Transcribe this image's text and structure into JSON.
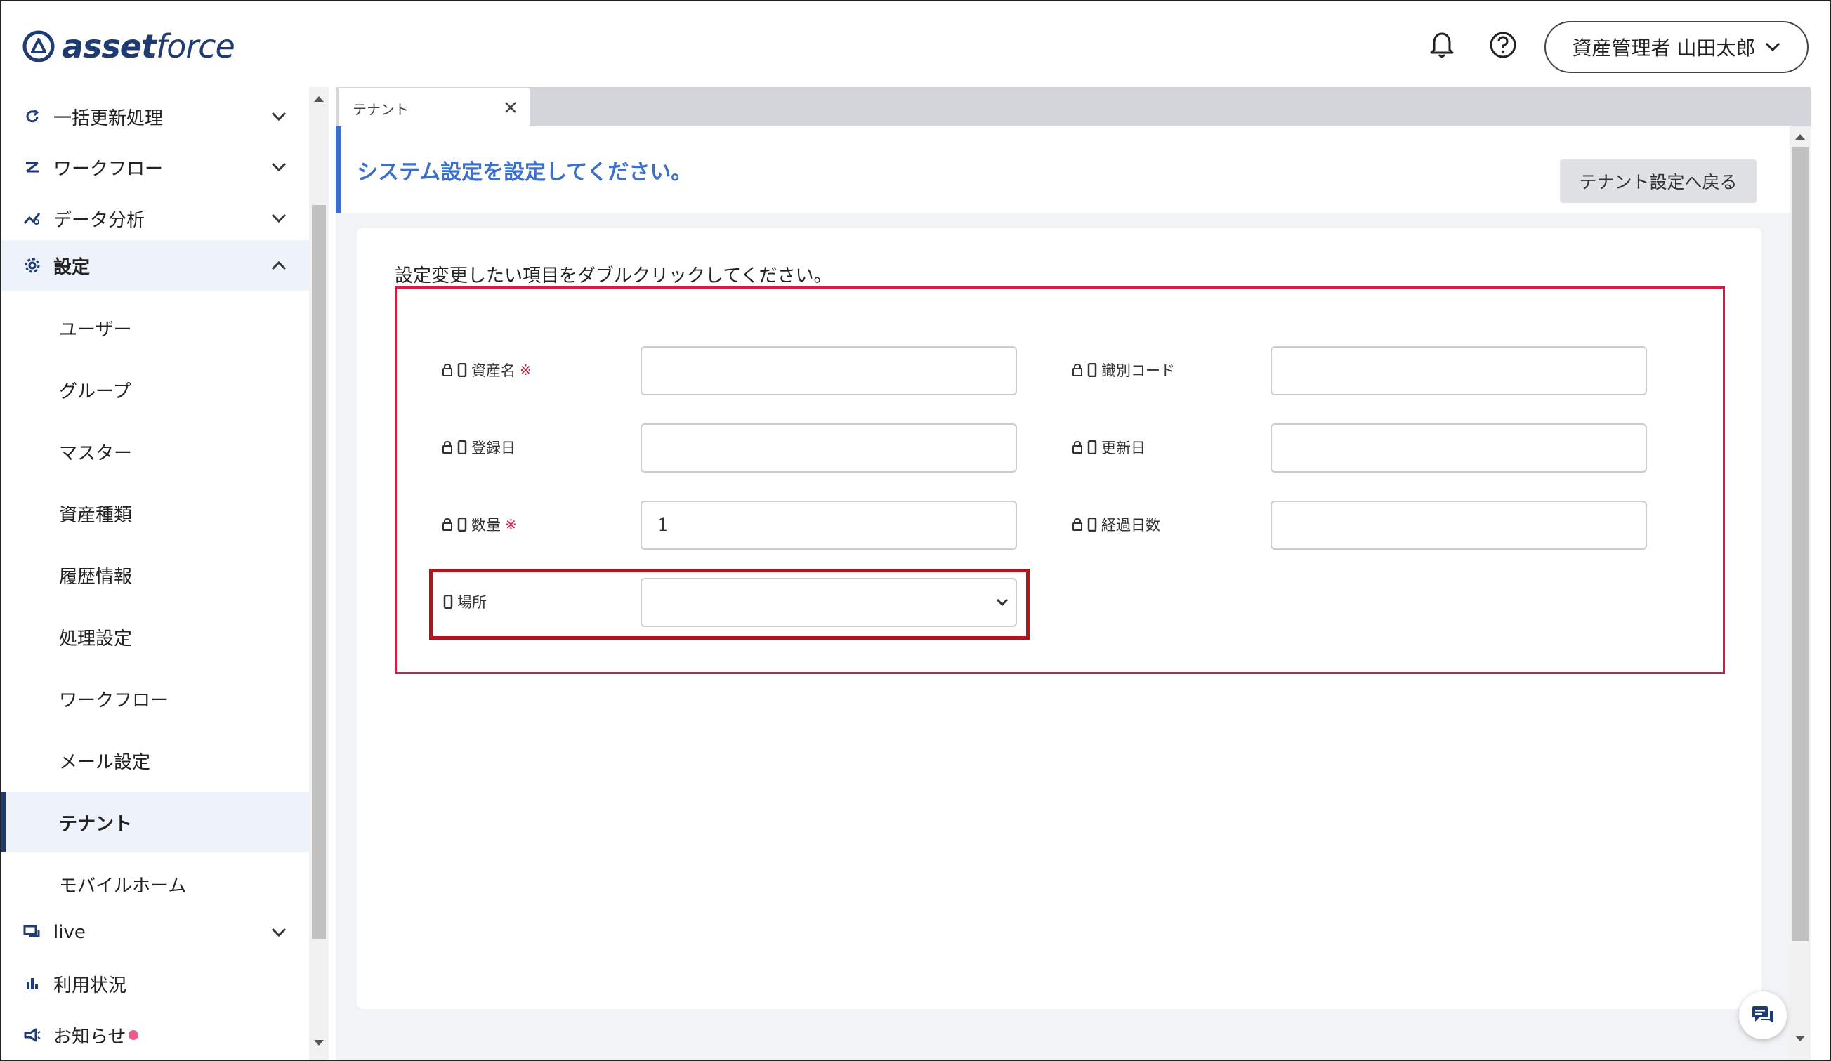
{
  "header": {
    "logo_text_main": "asset",
    "logo_text_sub": "force",
    "user_name": "資産管理者 山田太郎"
  },
  "sidebar": {
    "items": [
      {
        "label": "一括更新処理",
        "icon": "refresh-icon"
      },
      {
        "label": "ワークフロー",
        "icon": "workflow-icon"
      },
      {
        "label": "データ分析",
        "icon": "analytics-icon"
      },
      {
        "label": "設定",
        "icon": "gear-icon"
      }
    ],
    "sub_items": [
      "ユーザー",
      "グループ",
      "マスター",
      "資産種類",
      "履歴情報",
      "処理設定",
      "ワークフロー",
      "メール設定",
      "テナント",
      "モバイルホーム"
    ],
    "bottom_items": [
      {
        "label": "live",
        "icon": "chat-icon"
      },
      {
        "label": "利用状況",
        "icon": "bar-chart-icon"
      },
      {
        "label": "お知らせ",
        "icon": "megaphone-icon"
      }
    ]
  },
  "tabs": [
    {
      "label": "テナント"
    }
  ],
  "main": {
    "title": "システム設定を設定してください。",
    "back_button": "テナント設定へ戻る",
    "instruction": "設定変更したい項目をダブルクリックしてください。",
    "required_mark": "※",
    "fields": [
      {
        "label": "資産名",
        "required": true,
        "value": ""
      },
      {
        "label": "識別コード",
        "required": false,
        "value": ""
      },
      {
        "label": "登録日",
        "required": false,
        "value": ""
      },
      {
        "label": "更新日",
        "required": false,
        "value": ""
      },
      {
        "label": "数量",
        "required": true,
        "value": "1"
      },
      {
        "label": "経過日数",
        "required": false,
        "value": ""
      },
      {
        "label": "場所",
        "required": false,
        "value": ""
      }
    ]
  },
  "colors": {
    "brand": "#1f3b73",
    "accent": "#3b6fc9",
    "required": "#d81b46",
    "highlight": "#b5121b"
  }
}
